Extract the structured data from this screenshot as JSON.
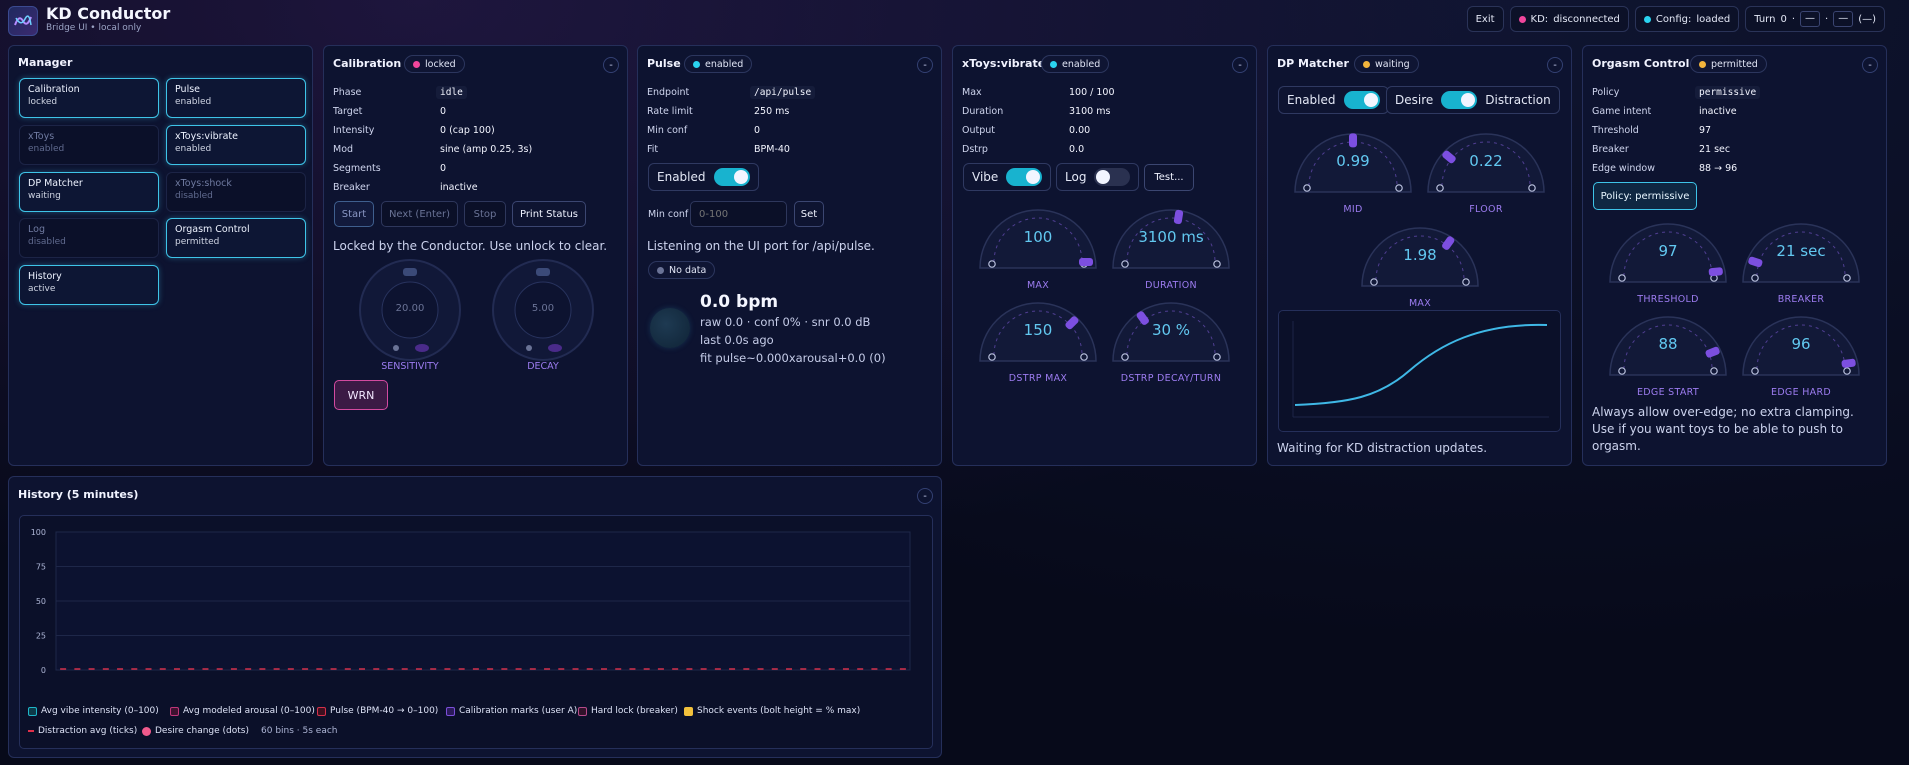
{
  "app": {
    "title": "KD Conductor",
    "subtitle": "Bridge UI • local only"
  },
  "topbar": {
    "exit_label": "Exit",
    "kd_label": "KD:",
    "kd_status": "disconnected",
    "config_label": "Config:",
    "config_status": "loaded",
    "turn_label": "Turn",
    "turn_value": "0",
    "turn_sep": "·",
    "turn_slot1": "—",
    "turn_slot2": "·",
    "turn_slot3": "—",
    "turn_slot4": "(—)"
  },
  "manager": {
    "title": "Manager",
    "items": [
      {
        "name": "Calibration",
        "status": "locked"
      },
      {
        "name": "Pulse",
        "status": "enabled"
      },
      {
        "name": "xToys",
        "status": "enabled"
      },
      {
        "name": "xToys:vibrate",
        "status": "enabled"
      },
      {
        "name": "DP Matcher",
        "status": "waiting"
      },
      {
        "name": "xToys:shock",
        "status": "disabled"
      },
      {
        "name": "Log",
        "status": "disabled"
      },
      {
        "name": "Orgasm Control",
        "status": "permitted"
      },
      {
        "name": "History",
        "status": "active"
      }
    ]
  },
  "calibration": {
    "title": "Calibration",
    "badge": "locked",
    "collapse": "-",
    "fields": [
      {
        "k": "Phase",
        "v": "idle"
      },
      {
        "k": "Target",
        "v": "0"
      },
      {
        "k": "Intensity",
        "v": "0 (cap 100)"
      },
      {
        "k": "Mod",
        "v": "sine (amp 0.25, 3s)"
      },
      {
        "k": "Segments",
        "v": "0"
      },
      {
        "k": "Breaker",
        "v": "inactive"
      }
    ],
    "buttons": {
      "start": "Start",
      "next": "Next (Enter)",
      "stop": "Stop",
      "print": "Print Status"
    },
    "message": "Locked by the Conductor. Use unlock to clear.",
    "knobs": [
      {
        "label": "SENSITIVITY",
        "value": "20.00"
      },
      {
        "label": "DECAY",
        "value": "5.00"
      }
    ],
    "wrn_label": "WRN"
  },
  "pulse": {
    "title": "Pulse",
    "badge": "enabled",
    "collapse": "-",
    "fields": [
      {
        "k": "Endpoint",
        "v": "/api/pulse"
      },
      {
        "k": "Rate limit",
        "v": "250 ms"
      },
      {
        "k": "Min conf",
        "v": "0"
      },
      {
        "k": "Fit",
        "v": "BPM-40"
      }
    ],
    "enabled_label": "Enabled",
    "min_conf_label": "Min conf",
    "min_conf_placeholder": "0-100",
    "set_label": "Set",
    "listening": "Listening on the UI port for /api/pulse.",
    "no_data": "No data",
    "bpm": "0.0 bpm",
    "raw": "raw 0.0 · conf 0% · snr 0.0 dB",
    "last": "last 0.0s ago",
    "fit": "fit pulse~0.000xarousal+0.0 (0)"
  },
  "vibrate": {
    "title": "xToys:vibrate",
    "badge": "enabled",
    "collapse": "-",
    "fields": [
      {
        "k": "Max",
        "v": "100 / 100"
      },
      {
        "k": "Duration",
        "v": "3100 ms"
      },
      {
        "k": "Output",
        "v": "0.00"
      },
      {
        "k": "Dstrp",
        "v": "0.0"
      }
    ],
    "vibe_label": "Vibe",
    "log_label": "Log",
    "test_label": "Test...",
    "gauges": [
      {
        "label": "MAX",
        "value": "100",
        "level": 1.0
      },
      {
        "label": "DURATION",
        "value": "3100 ms",
        "level": 0.55
      },
      {
        "label": "DSTRP MAX",
        "value": "150",
        "level": 0.75
      },
      {
        "label": "DSTRP DECAY/TURN",
        "value": "30 %",
        "level": 0.3
      }
    ]
  },
  "dpmatcher": {
    "title": "DP Matcher",
    "badge": "waiting",
    "collapse": "-",
    "enabled_label": "Enabled",
    "desire_label": "Desire",
    "distraction_label": "Distraction",
    "gauges": [
      {
        "label": "MID",
        "value": "0.99",
        "level": 0.5
      },
      {
        "label": "FLOOR",
        "value": "0.22",
        "level": 0.22
      },
      {
        "label": "MAX",
        "value": "1.98",
        "level": 0.7
      }
    ],
    "message": "Waiting for KD distraction updates."
  },
  "orgasm": {
    "title": "Orgasm Control",
    "badge": "permitted",
    "collapse": "-",
    "fields": [
      {
        "k": "Policy",
        "v": "permissive"
      },
      {
        "k": "Game intent",
        "v": "inactive"
      },
      {
        "k": "Threshold",
        "v": "97"
      },
      {
        "k": "Breaker",
        "v": "21 sec"
      },
      {
        "k": "Edge window",
        "v": "88 → 96"
      }
    ],
    "policy_button": "Policy: permissive",
    "gauges": [
      {
        "label": "THRESHOLD",
        "value": "97",
        "level": 0.97
      },
      {
        "label": "BREAKER",
        "value": "21 sec",
        "level": 0.1
      },
      {
        "label": "EDGE START",
        "value": "88",
        "level": 0.88
      },
      {
        "label": "EDGE HARD",
        "value": "96",
        "level": 0.96
      }
    ],
    "message": "Always allow over-edge; no extra clamping. Use if you want toys to be able to push to orgasm."
  },
  "history": {
    "title": "History (5 minutes)",
    "collapse": "-",
    "legend": [
      {
        "label": "Avg vibe intensity (0–100)",
        "color": "#1fb6c9"
      },
      {
        "label": "Avg modeled arousal (0–100)",
        "color": "#c0367a"
      },
      {
        "label": "Pulse (BPM-40 → 0–100)",
        "color": "#d4304a"
      },
      {
        "label": "Calibration marks (user A)",
        "color": "#7b4fd8"
      },
      {
        "label": "Hard lock (breaker)",
        "color": "#b54a8a"
      },
      {
        "label": "Shock events (bolt height = % max)",
        "color": "#f2c13c"
      },
      {
        "label": "Distraction avg (ticks)",
        "color": "#e0304a"
      },
      {
        "label": "Desire change (dots)",
        "color": "#f05a8c"
      }
    ],
    "bins_note": "60 bins · 5s each",
    "chart_data": {
      "type": "line",
      "title": "",
      "ylim": [
        0,
        100
      ],
      "yticks": [
        "100",
        "75",
        "50",
        "25",
        "0"
      ],
      "series": [
        {
          "name": "Pulse (BPM-40 → 0–100)",
          "values": [
            0,
            0,
            0,
            0,
            0,
            0,
            0,
            0,
            0,
            0,
            0,
            0,
            0,
            0,
            0,
            0,
            0,
            0,
            0,
            0,
            0,
            0,
            0,
            0,
            0,
            0,
            0,
            0,
            0,
            0,
            0,
            0,
            0,
            0,
            0,
            0,
            0,
            0,
            0,
            0,
            0,
            0,
            0,
            0,
            0,
            0,
            0,
            0,
            0,
            0,
            0,
            0,
            0,
            0,
            0,
            0,
            0,
            0,
            0,
            0
          ]
        }
      ]
    }
  }
}
